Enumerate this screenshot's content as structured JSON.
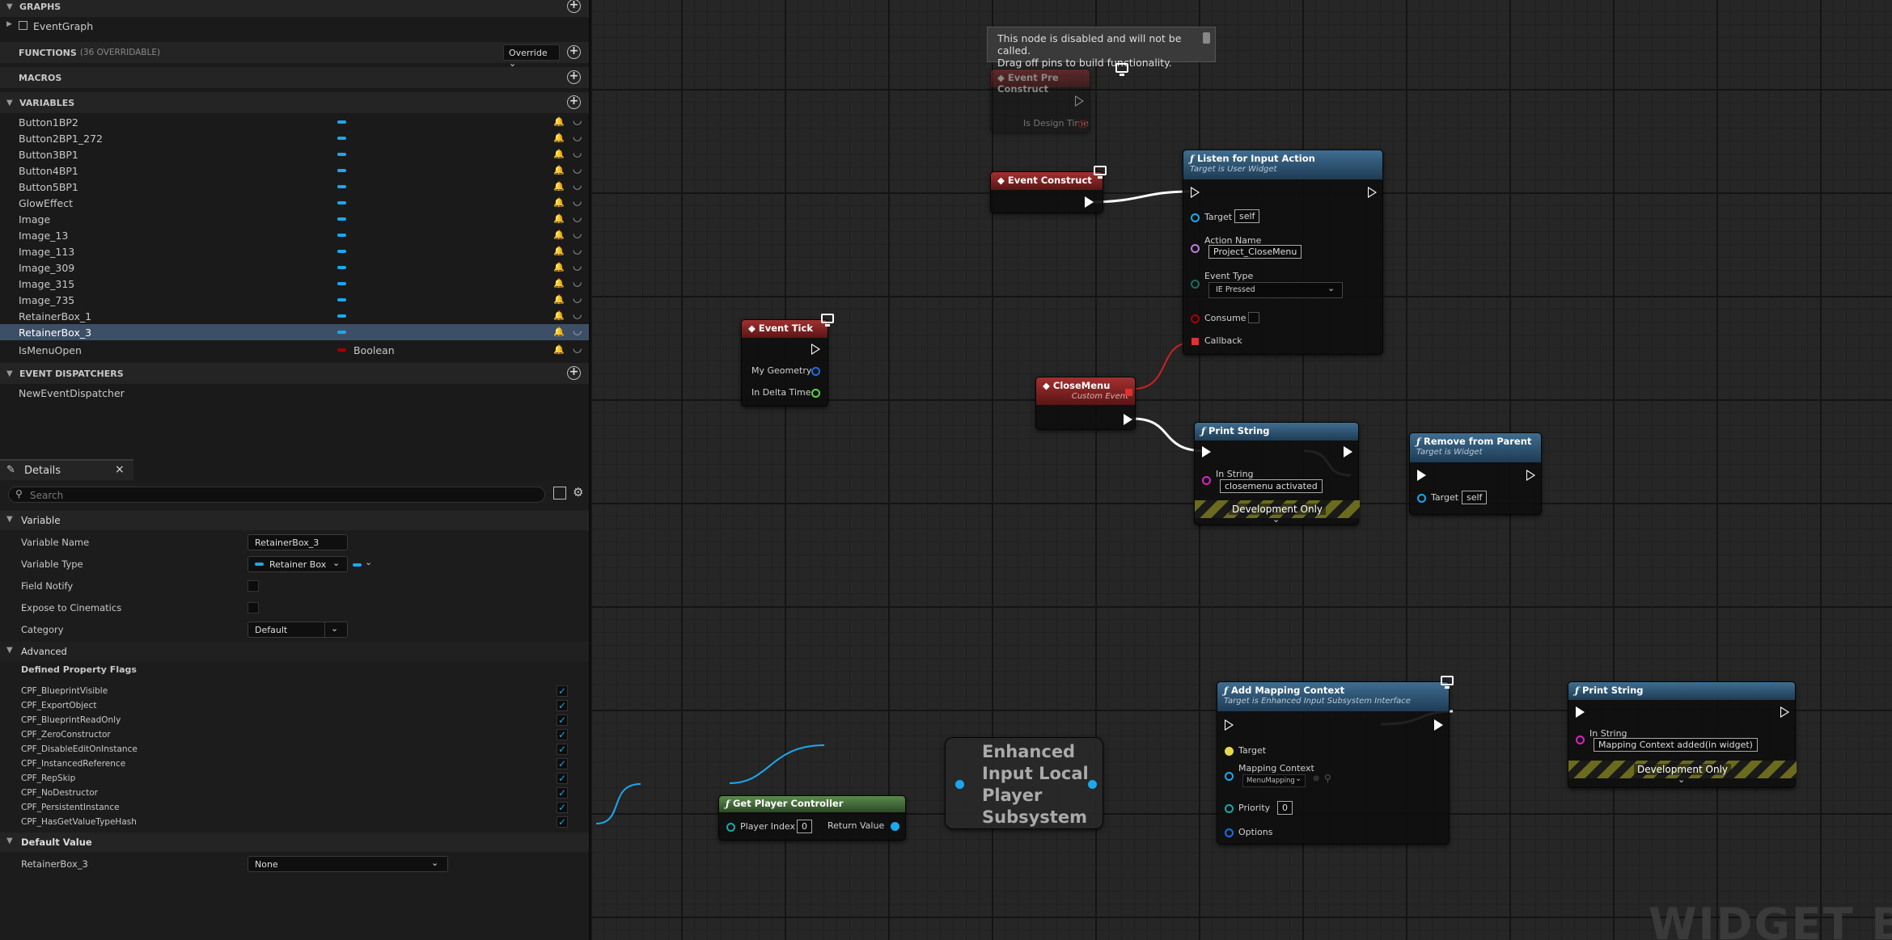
{
  "sections": {
    "graphs": "GRAPHS",
    "event_graph": "EventGraph",
    "functions": "FUNCTIONS",
    "functions_count": "(36 OVERRIDABLE)",
    "override": "Override",
    "macros": "MACROS",
    "variables": "VARIABLES",
    "event_dispatchers": "EVENT DISPATCHERS",
    "dispatcher_item": "NewEventDispatcher"
  },
  "variables": [
    {
      "name": "Button1BP2"
    },
    {
      "name": "Button2BP1_272"
    },
    {
      "name": "Button3BP1"
    },
    {
      "name": "Button4BP1"
    },
    {
      "name": "Button5BP1"
    },
    {
      "name": "GlowEffect"
    },
    {
      "name": "Image"
    },
    {
      "name": "Image_13"
    },
    {
      "name": "Image_113"
    },
    {
      "name": "Image_309"
    },
    {
      "name": "Image_315"
    },
    {
      "name": "Image_735"
    },
    {
      "name": "RetainerBox_1"
    },
    {
      "name": "RetainerBox_3"
    }
  ],
  "bool_var": {
    "name": "IsMenuOpen",
    "type": "Boolean"
  },
  "details": {
    "tab": "Details",
    "search_placeholder": "Search",
    "variable_cat": "Variable",
    "variable_name_label": "Variable Name",
    "variable_name_value": "RetainerBox_3",
    "variable_type_label": "Variable Type",
    "variable_type_value": "Retainer Box",
    "field_notify": "Field Notify",
    "expose": "Expose to Cinematics",
    "category_label": "Category",
    "category_value": "Default",
    "advanced": "Advanced",
    "defined_flags": "Defined Property Flags",
    "flags": [
      "CPF_BlueprintVisible",
      "CPF_ExportObject",
      "CPF_BlueprintReadOnly",
      "CPF_ZeroConstructor",
      "CPF_DisableEditOnInstance",
      "CPF_InstancedReference",
      "CPF_RepSkip",
      "CPF_NoDestructor",
      "CPF_PersistentInstance",
      "CPF_HasGetValueTypeHash"
    ],
    "default_value": "Default Value",
    "default_var": "RetainerBox_3",
    "default_select": "None"
  },
  "graph": {
    "tooltip": [
      "This node is disabled and will not be called.",
      "Drag off pins to build functionality."
    ],
    "pre_construct": {
      "title": "Event Pre Construct",
      "pin": "Is Design Time"
    },
    "construct": {
      "title": "Event Construct"
    },
    "tick": {
      "title": "Event Tick",
      "pins": [
        "My Geometry",
        "In Delta Time"
      ]
    },
    "listen": {
      "title": "Listen for Input Action",
      "sub": "Target is User Widget",
      "target": "Target",
      "target_val": "self",
      "action_name": "Action Name",
      "action_val": "Project_CloseMenu",
      "event_type": "Event Type",
      "event_val": "IE Pressed",
      "consume": "Consume",
      "callback": "Callback"
    },
    "close_menu": {
      "title": "CloseMenu",
      "sub": "Custom Event"
    },
    "print1": {
      "title": "Print String",
      "in_string": "In String",
      "val": "closemenu activated",
      "dev": "Development Only"
    },
    "remove": {
      "title": "Remove from Parent",
      "sub": "Target is Widget",
      "target": "Target",
      "val": "self"
    },
    "mapping": {
      "title": "Add Mapping Context",
      "sub": "Target is Enhanced Input Subsystem Interface",
      "target": "Target",
      "mc": "Mapping Context",
      "mc_val": "MenuMapping",
      "priority": "Priority",
      "priority_val": "0",
      "options": "Options"
    },
    "print2": {
      "title": "Print String",
      "in_string": "In String",
      "val": "Mapping Context added(in widget)",
      "dev": "Development Only"
    },
    "enhanced": {
      "lines": [
        "Enhanced",
        "Input Local",
        "Player",
        "Subsystem"
      ]
    },
    "gpc": {
      "title": "Get Player Controller",
      "player_index": "Player Index",
      "pi_val": "0",
      "ret": "Return Value"
    },
    "watermark": "WIDGET BLU"
  },
  "colors": {
    "accent": "#1aa8ee",
    "selected_row": "#3c4f66",
    "bool": "#a00000"
  }
}
